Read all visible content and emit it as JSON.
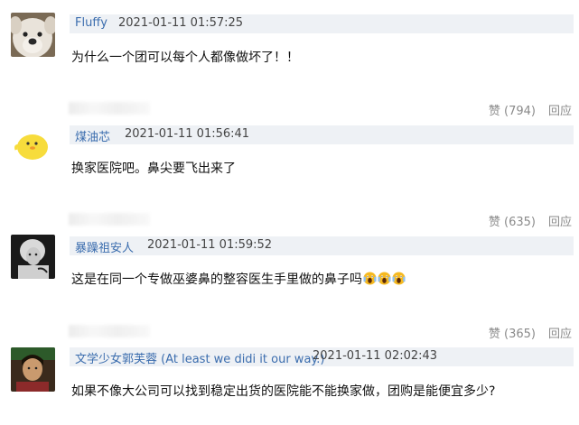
{
  "comments": [
    {
      "username": "Fluffy",
      "time": "2021-01-11 01:57:25",
      "text": "为什么一个团可以每个人都像做坏了！！",
      "like_label": "赞 (794)",
      "reply_label": "回应"
    },
    {
      "username": "煤油芯",
      "time": "2021-01-11 01:56:41",
      "text": "换家医院吧。鼻尖要飞出来了",
      "like_label": "赞 (635)",
      "reply_label": "回应"
    },
    {
      "username": "暴躁祖安人",
      "time": "2021-01-11 01:59:52",
      "text": "这是在同一个专做巫婆鼻的整容医生手里做的鼻子吗",
      "like_label": "赞 (365)",
      "reply_label": "回应"
    },
    {
      "username": "文学少女郭芙蓉 (At least we didi it our way.)",
      "time": "2021-01-11 02:02:43",
      "text": "如果不像大公司可以找到稳定出货的医院能不能换家做，团购是能便宜多少?"
    }
  ],
  "icons": {
    "c0_avatar": "dog-avatar",
    "c1_avatar": "yellow-chick-avatar",
    "c2_avatar": "woman-bw-avatar",
    "c3_avatar": "person-avatar",
    "c2_emoji": "screaming-face-emoji"
  },
  "colors": {
    "username": "#3b6dae",
    "meta_bar_bg": "#eef1f5",
    "action_text": "#8a8a8a"
  }
}
